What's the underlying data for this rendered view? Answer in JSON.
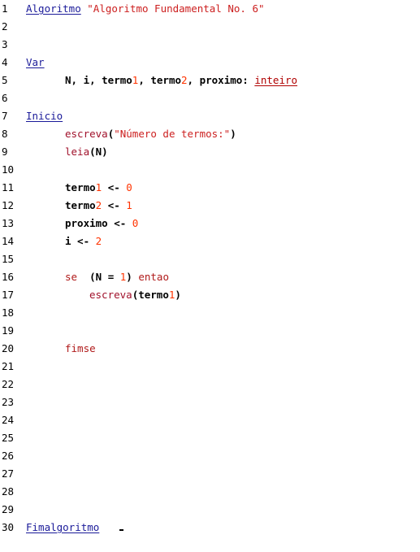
{
  "line_numbers": [
    "1",
    "2",
    "3",
    "4",
    "5",
    "6",
    "7",
    "8",
    "9",
    "10",
    "11",
    "12",
    "13",
    "14",
    "15",
    "16",
    "17",
    "18",
    "19",
    "20",
    "21",
    "22",
    "23",
    "24",
    "25",
    "26",
    "27",
    "28",
    "29",
    "30"
  ],
  "l1": {
    "kw": "Algoritmo",
    "str": "\"Algoritmo Fundamental No. 6\""
  },
  "l4": {
    "kw": "Var"
  },
  "l5": {
    "vars": "N, i, termo",
    "d1": "1",
    "mid": ", termo",
    "d2": "2",
    "rest": ", proximo: ",
    "type": "inteiro"
  },
  "l7": {
    "kw": "Inicio"
  },
  "l8": {
    "fn": "escreva",
    "open": "(",
    "str": "\"Número de termos:\"",
    "close": ")"
  },
  "l9": {
    "fn": "leia",
    "args": "(N)"
  },
  "l11": {
    "var": "termo",
    "d": "1",
    "op": " <- ",
    "val": "0"
  },
  "l12": {
    "var": "termo",
    "d": "2",
    "op": " <- ",
    "val": "1"
  },
  "l13": {
    "var": "proximo",
    "op": " <- ",
    "val": "0"
  },
  "l14": {
    "var": "i",
    "op": " <- ",
    "val": "2"
  },
  "l16": {
    "kw": "se",
    "open": "  (N = ",
    "val": "1",
    "close": ")",
    "then": " entao"
  },
  "l17": {
    "fn": "escreva",
    "open": "(termo",
    "d": "1",
    "close": ")"
  },
  "l20": {
    "kw": "fimse"
  },
  "l30": {
    "kw": "Fimalgoritmo"
  }
}
